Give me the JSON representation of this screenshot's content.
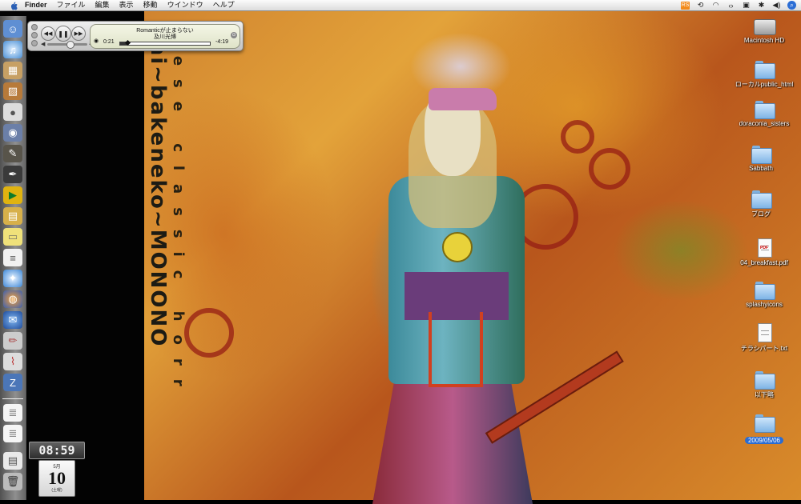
{
  "menubar": {
    "app_name": "Finder",
    "items": [
      "ファイル",
      "編集",
      "表示",
      "移動",
      "ウインドウ",
      "ヘルプ"
    ]
  },
  "wallpaper": {
    "text_main": "Mononoke ~bakeneko~ Japanese classic horror",
    "text_vertical_1": "Shi~bakeneko~MONONO",
    "text_vertical_2": "nese classic horr"
  },
  "itunes": {
    "song_title": "Romanticが止まらない",
    "artist": "及川光博",
    "elapsed": "0:21",
    "remaining": "-4:19",
    "progress": 0.08,
    "volume": 0.55
  },
  "clock": {
    "time": "08:59"
  },
  "calendar": {
    "month": "5月",
    "day": "10",
    "weekday": "(土曜)"
  },
  "desktop_icons": [
    {
      "label": "Macintosh HD",
      "kind": "hd"
    },
    {
      "label": "ローカルpublic_html",
      "kind": "folder"
    },
    {
      "label": "doraconia_sisters",
      "kind": "folder"
    },
    {
      "label": "Sabbath",
      "kind": "folder"
    },
    {
      "label": "ブログ",
      "kind": "folder"
    },
    {
      "label": "04_breakfast.pdf",
      "kind": "pdf"
    },
    {
      "label": "splashyicons",
      "kind": "folder"
    },
    {
      "label": "チラシパート.txt",
      "kind": "doc"
    },
    {
      "label": "以下略",
      "kind": "folder"
    },
    {
      "label": "2009/05/06",
      "kind": "folder",
      "selected": true
    }
  ],
  "dock_items": [
    "finder-icon",
    "itunes-icon",
    "iphoto-icon",
    "photo-icon",
    "apple-icon",
    "preview-icon",
    "quill-icon",
    "app-icon",
    "vlc-icon",
    "truck-icon",
    "stickies-icon",
    "textedit-icon",
    "safari-icon",
    "firefox-icon",
    "thunderbird-icon",
    "pencil-icon",
    "grapher-icon",
    "zterm-icon",
    "doc-icon",
    "doc-icon",
    "mail-icon",
    "trash-icon"
  ],
  "colors": {
    "selection": "#2a6cd2",
    "menubar": "#e8e8e8"
  }
}
